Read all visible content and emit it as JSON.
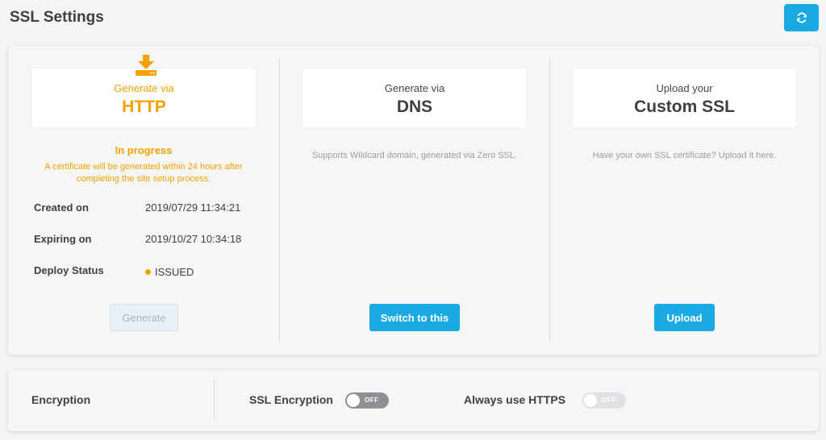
{
  "page": {
    "title": "SSL Settings"
  },
  "toolbar": {
    "refresh_icon": "refresh-icon"
  },
  "http_option": {
    "sub": "Generate via",
    "main": "HTTP",
    "icon": "download-icon",
    "progress_title": "In progress",
    "progress_line1": "A certificate will be generated within 24 hours after",
    "progress_line2": "completing the site setup process.",
    "created_label": "Created on",
    "created_value": "2019/07/29 11:34:21",
    "expiring_label": "Expiring on",
    "expiring_value": "2019/10/27 10:34:18",
    "deploy_label": "Deploy Status",
    "deploy_value": "ISSUED",
    "generate_label": "Generate"
  },
  "dns_option": {
    "sub": "Generate via",
    "main": "DNS",
    "description": "Supports Wildcard domain, generated via Zero SSL.",
    "button_label": "Switch to this"
  },
  "custom_option": {
    "sub": "Upload your",
    "main": "Custom SSL",
    "description": "Have your own SSL certificate? Upload it here.",
    "button_label": "Upload"
  },
  "encryption": {
    "section_label": "Encryption",
    "ssl_label": "SSL Encryption",
    "ssl_state": "OFF",
    "https_label": "Always use HTTPS",
    "https_state": "OFF"
  },
  "colors": {
    "accent": "#1aa9e2",
    "active": "#f2a100",
    "text": "#3d3f44"
  }
}
